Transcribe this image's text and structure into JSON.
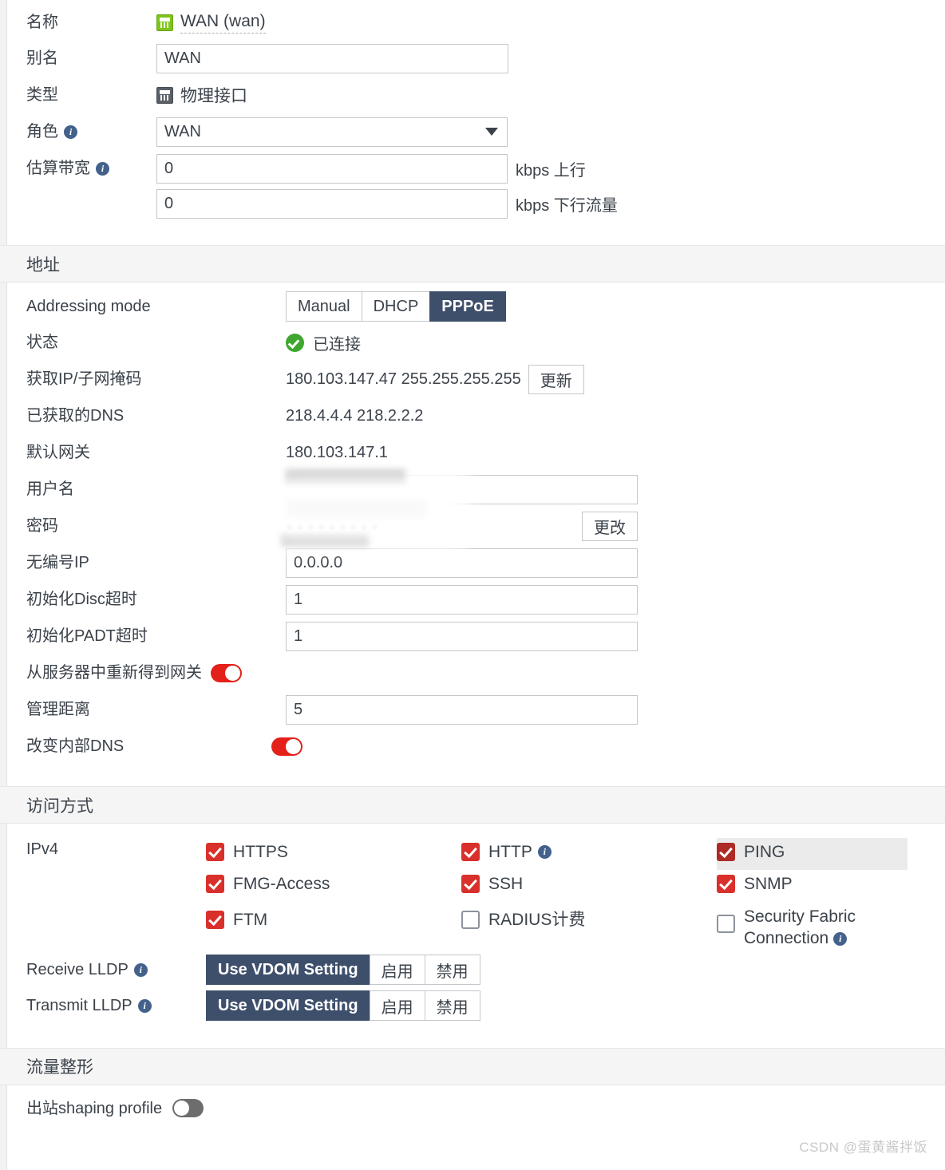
{
  "basic": {
    "name_label": "名称",
    "name_value": "WAN (wan)",
    "name_icon": "rj45-port-icon-green",
    "alias_label": "别名",
    "alias_value": "WAN",
    "type_label": "类型",
    "type_value": "物理接口",
    "type_icon": "rj45-port-icon-gray",
    "role_label": "角色",
    "role_value": "WAN",
    "bandwidth_label": "估算带宽",
    "bandwidth_up_value": "0",
    "bandwidth_up_unit": "kbps 上行",
    "bandwidth_down_value": "0",
    "bandwidth_down_unit": "kbps 下行流量"
  },
  "address": {
    "section_title": "地址",
    "mode_label": "Addressing mode",
    "mode_options": [
      "Manual",
      "DHCP",
      "PPPoE"
    ],
    "mode_selected": "PPPoE",
    "status_label": "状态",
    "status_value": "已连接",
    "status_icon": "check-circle-icon",
    "ip_label": "获取IP/子网掩码",
    "ip_value": "180.103.147.47 255.255.255.255",
    "ip_button": "更新",
    "dns_label": "已获取的DNS",
    "dns_value": "218.4.4.4  218.2.2.2",
    "gateway_label": "默认网关",
    "gateway_value": "",
    "username_label": "用户名",
    "username_value": "",
    "password_label": "密码",
    "password_value": "●●●●●●●●●",
    "password_button": "更改",
    "unnumbered_label": "无编号IP",
    "unnumbered_value": "0.0.0.0",
    "disc_label": "初始化Disc超时",
    "disc_value": "1",
    "padt_label": "初始化PADT超时",
    "padt_value": "1",
    "retrieve_gw_label": "从服务器中重新得到网关",
    "retrieve_gw_on": true,
    "distance_label": "管理距离",
    "distance_value": "5",
    "override_dns_label": "改变内部DNS",
    "override_dns_on": true
  },
  "access": {
    "section_title": "访问方式",
    "ipv4_label": "IPv4",
    "items": [
      {
        "label": "HTTPS",
        "checked": true,
        "info": false,
        "col": 1,
        "row": 1
      },
      {
        "label": "FMG-Access",
        "checked": true,
        "info": false,
        "col": 1,
        "row": 2
      },
      {
        "label": "FTM",
        "checked": true,
        "info": false,
        "col": 1,
        "row": 3
      },
      {
        "label": "HTTP",
        "checked": true,
        "info": true,
        "col": 2,
        "row": 1
      },
      {
        "label": "SSH",
        "checked": true,
        "info": false,
        "col": 2,
        "row": 2
      },
      {
        "label": "RADIUS计费",
        "checked": false,
        "info": false,
        "col": 2,
        "row": 3
      },
      {
        "label": "PING",
        "checked": true,
        "info": false,
        "col": 3,
        "row": 1
      },
      {
        "label": "SNMP",
        "checked": true,
        "info": false,
        "col": 3,
        "row": 2
      },
      {
        "label": "Security Fabric Connection",
        "checked": false,
        "info": true,
        "col": 3,
        "row": 3
      }
    ],
    "receive_lldp_label": "Receive LLDP",
    "transmit_lldp_label": "Transmit LLDP",
    "lldp_options": [
      "Use VDOM Setting",
      "启用",
      "禁用"
    ],
    "lldp_selected": "Use VDOM Setting"
  },
  "shaping": {
    "section_title": "流量整形",
    "outbound_label": "出站shaping profile",
    "outbound_on": false
  },
  "watermark": "CSDN @蛋黄酱拌饭",
  "colors": {
    "accent_red": "#d9302c",
    "active_navy": "#3e4f6b",
    "toggle_on": "#e3201a",
    "status_green": "#3fa72f",
    "port_green": "#7fc41a"
  }
}
